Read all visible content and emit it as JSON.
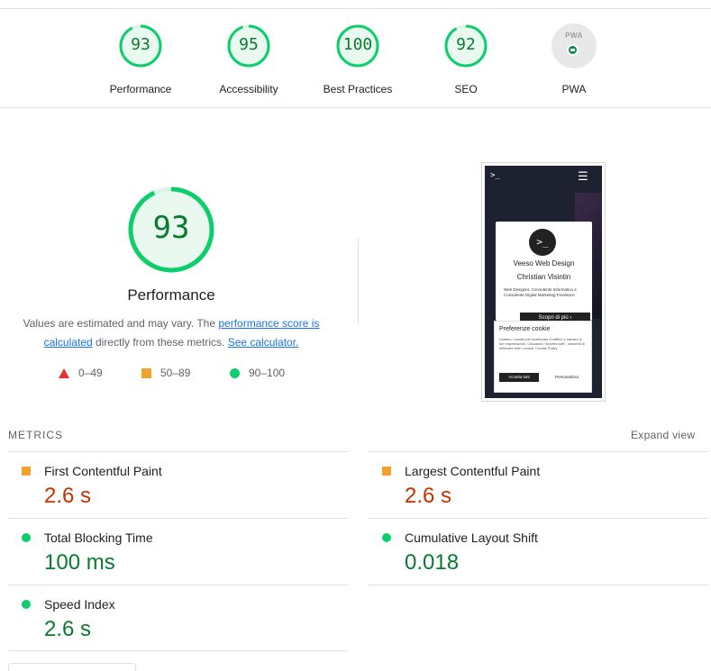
{
  "gauges": [
    {
      "label": "Performance",
      "score": "93",
      "fraction": 0.93,
      "color": "#0cce6b"
    },
    {
      "label": "Accessibility",
      "score": "95",
      "fraction": 0.95,
      "color": "#0cce6b"
    },
    {
      "label": "Best Practices",
      "score": "100",
      "fraction": 1.0,
      "color": "#0cce6b"
    },
    {
      "label": "SEO",
      "score": "92",
      "fraction": 0.92,
      "color": "#0cce6b"
    },
    {
      "label": "PWA",
      "badge_text": "PWA",
      "icon": "pwa-badge-icon"
    }
  ],
  "performance": {
    "score": "93",
    "fraction": 0.93,
    "title": "Performance",
    "desc_prefix": "Values are estimated and may vary. The ",
    "desc_link1": "performance score is calculated",
    "desc_middle": " directly from these metrics. ",
    "desc_link2": "See calculator."
  },
  "legend": [
    {
      "range": "0–49",
      "icon": "triangle-fail-icon",
      "color": "#e5322d"
    },
    {
      "range": "50–89",
      "icon": "square-average-icon",
      "color": "#f0a12f"
    },
    {
      "range": "90–100",
      "icon": "circle-pass-icon",
      "color": "#0cce6b"
    }
  ],
  "screenshot": {
    "logo": ">_",
    "menu": "☰",
    "avatar": ">_",
    "name": "Veeso Web Design",
    "subtitle": "Christian Visintin",
    "desc": "Web Designer, Consulente Informatico e Consulente Digital Marketing Freelance",
    "cta": "Scopri di più ›",
    "cookie_title": "Preferenze cookie",
    "cookie_text": "Usiamo i cookie per analizzare il traffico e salvare le tue impostazioni. Cliccando \"Accetta tutti\", consenti di utilizzare tutti i cookie. Cookie Policy",
    "cookie_accept": "Accetta tutti",
    "cookie_custom": "Personalizza"
  },
  "metrics": {
    "heading": "METRICS",
    "expand": "Expand view",
    "items": [
      {
        "name": "First Contentful Paint",
        "value": "2.6 s",
        "status": "average"
      },
      {
        "name": "Largest Contentful Paint",
        "value": "2.6 s",
        "status": "average"
      },
      {
        "name": "Total Blocking Time",
        "value": "100 ms",
        "status": "pass"
      },
      {
        "name": "Cumulative Layout Shift",
        "value": "0.018",
        "status": "pass"
      },
      {
        "name": "Speed Index",
        "value": "2.6 s",
        "status": "pass"
      }
    ]
  },
  "colors": {
    "pass": "#0cce6b",
    "pass_text": "#0a7a2f",
    "average": "#f0a12f",
    "average_text": "#c33300",
    "fail": "#e5322d",
    "link": "#1a73e8"
  }
}
